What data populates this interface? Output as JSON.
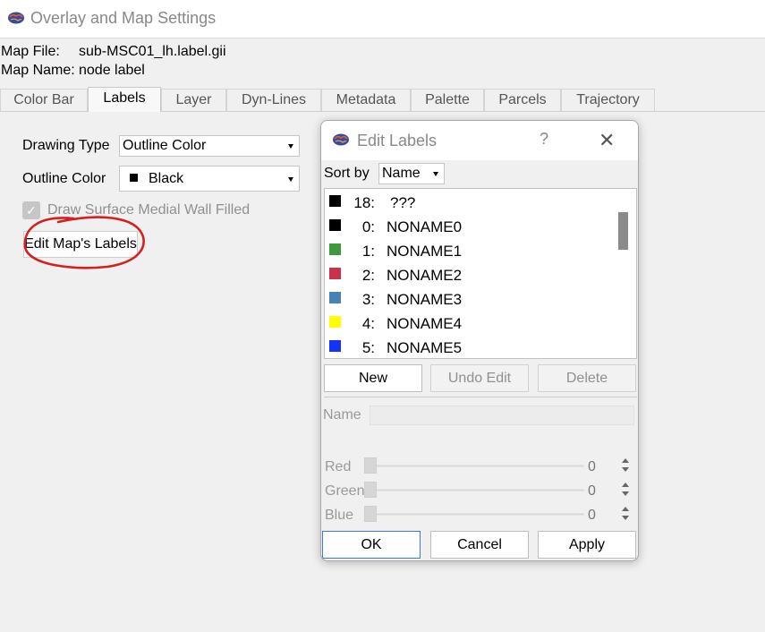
{
  "window": {
    "title": "Overlay and Map Settings",
    "icon": "brain-icon"
  },
  "map_info": {
    "file_label": "Map File:",
    "file_value": "sub-MSC01_lh.label.gii",
    "name_label": "Map Name:",
    "name_value": "node label"
  },
  "tabs": [
    "Color Bar",
    "Labels",
    "Layer",
    "Dyn-Lines",
    "Metadata",
    "Palette",
    "Parcels",
    "Trajectory"
  ],
  "active_tab": "Labels",
  "labels_tab": {
    "drawing_type_label": "Drawing Type",
    "drawing_type_value": "Outline Color",
    "outline_color_label": "Outline Color",
    "outline_color_value": "Black",
    "draw_medial_wall_label": "Draw Surface Medial Wall Filled",
    "draw_medial_wall_checked": true,
    "edit_button_label": "Edit Map's Labels",
    "annotation_color": "#d42020"
  },
  "dialog": {
    "title": "Edit Labels",
    "help": "?",
    "sort_by_label": "Sort by",
    "sort_by_value": "Name",
    "items": [
      {
        "key": "18:",
        "name": "???",
        "color": "#000000"
      },
      {
        "key": "0:",
        "name": "NONAME0",
        "color": "#000000"
      },
      {
        "key": "1:",
        "name": "NONAME1",
        "color": "#3c9a3c"
      },
      {
        "key": "2:",
        "name": "NONAME2",
        "color": "#c8324a"
      },
      {
        "key": "3:",
        "name": "NONAME3",
        "color": "#4682b4"
      },
      {
        "key": "4:",
        "name": "NONAME4",
        "color": "#ffff00"
      },
      {
        "key": "5:",
        "name": "NONAME5",
        "color": "#1432ff"
      }
    ],
    "new_label": "New",
    "undo_label": "Undo Edit",
    "delete_label": "Delete",
    "name_label": "Name",
    "red_label": "Red",
    "red_value": "0",
    "green_label": "Green",
    "green_value": "0",
    "blue_label": "Blue",
    "blue_value": "0",
    "ok_label": "OK",
    "cancel_label": "Cancel",
    "apply_label": "Apply"
  }
}
